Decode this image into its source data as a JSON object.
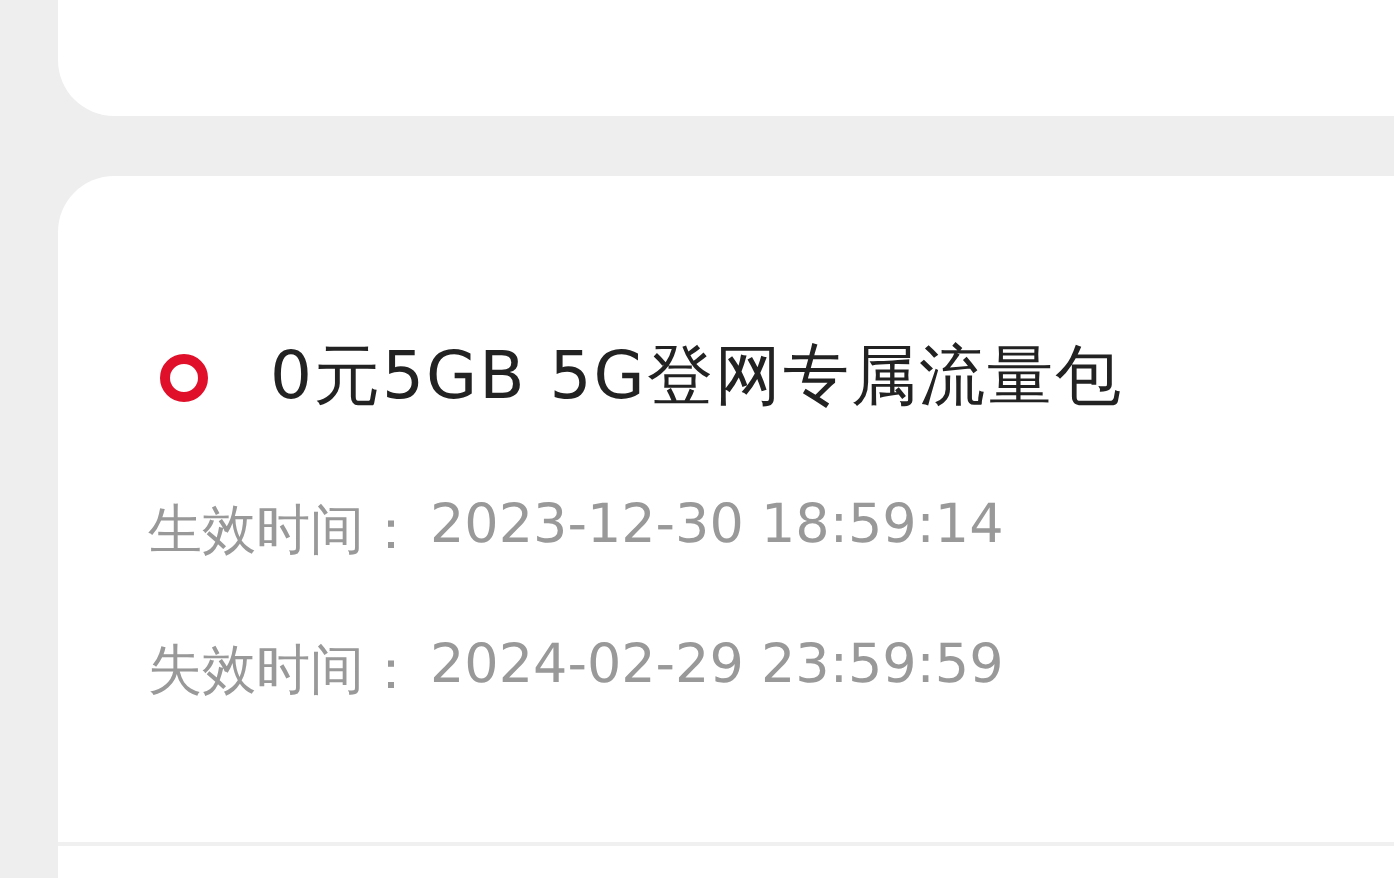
{
  "package": {
    "title": "0元5GB 5G登网专属流量包",
    "fields": [
      {
        "label": "生效时间：",
        "value": "2023-12-30 18:59:14"
      },
      {
        "label": "失效时间：",
        "value": "2024-02-29 23:59:59"
      }
    ]
  }
}
